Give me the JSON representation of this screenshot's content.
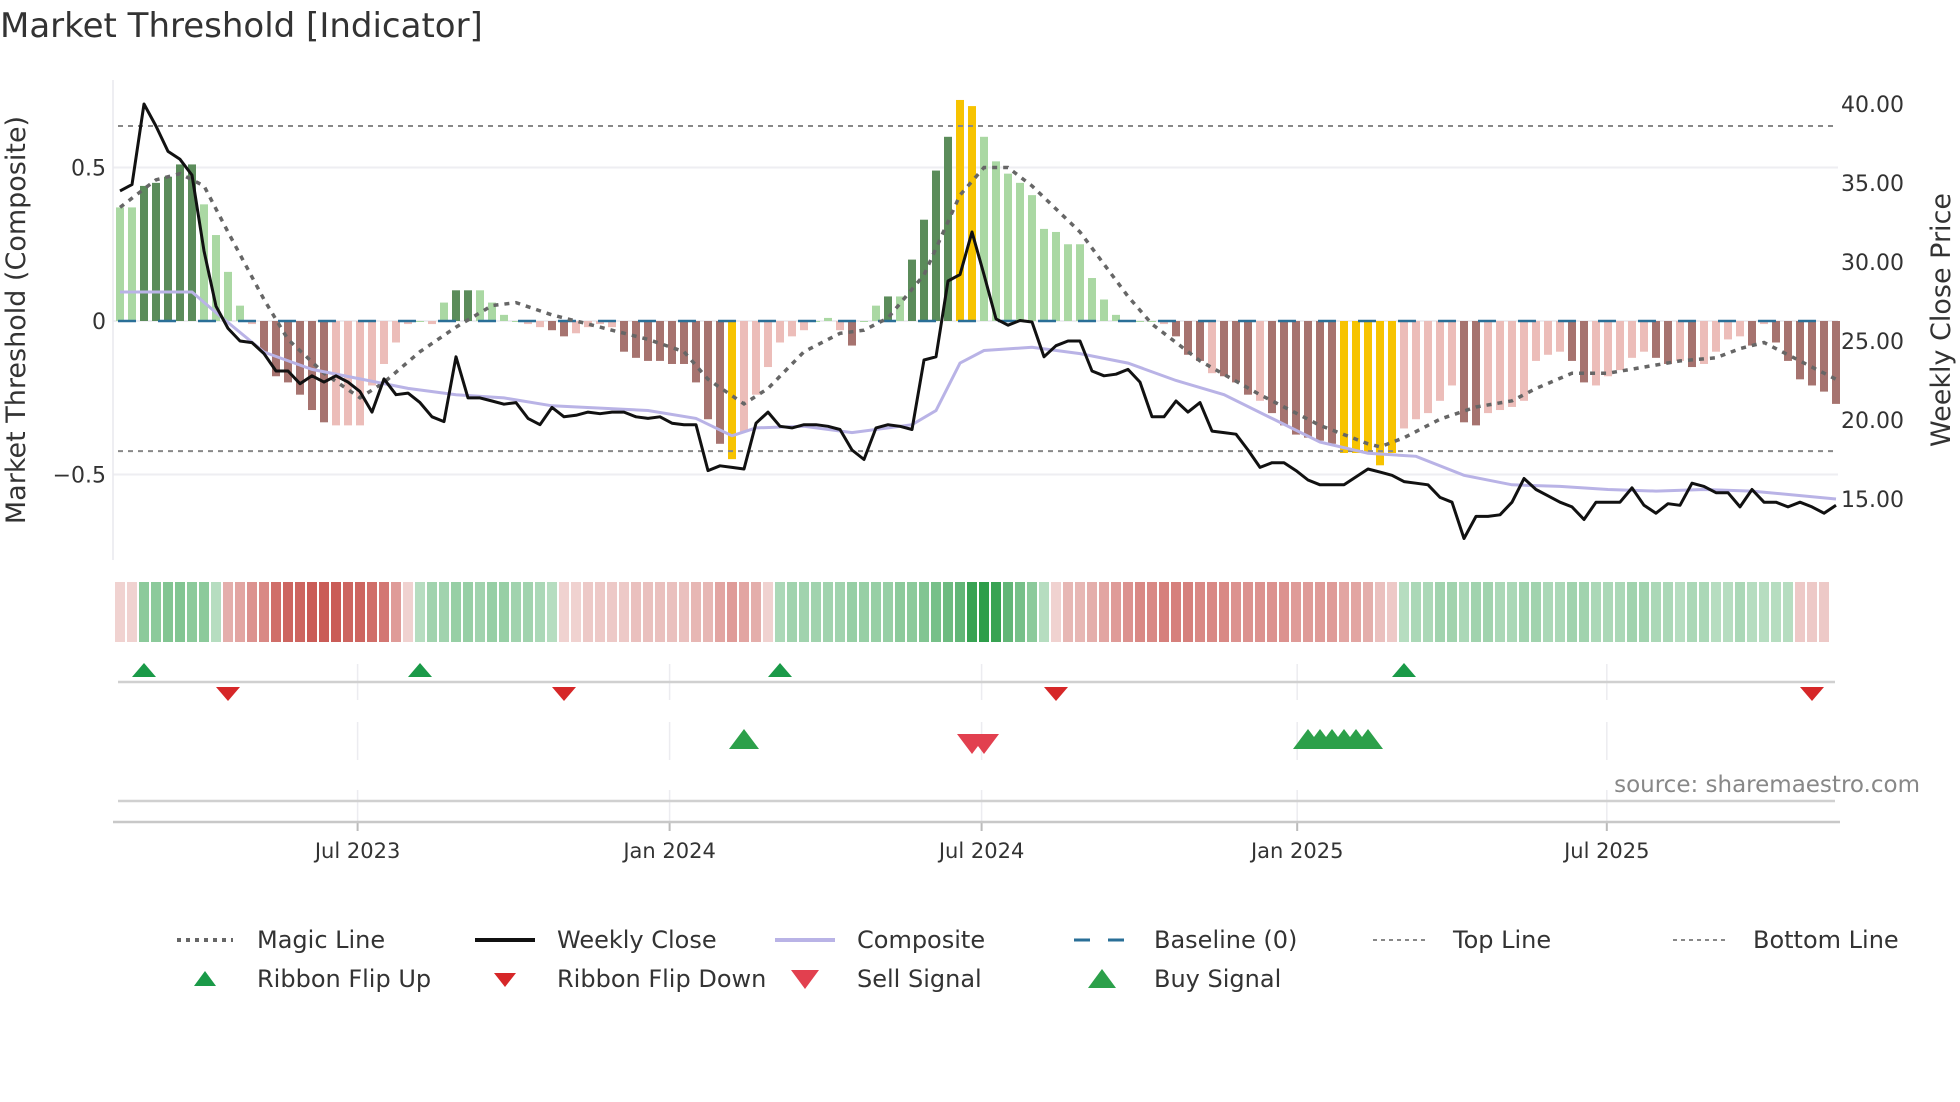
{
  "title": "Market Threshold [Indicator]",
  "source": "source: sharemaestro.com",
  "colors": {
    "dark_green": "#5b8c5a",
    "light_green": "#aad8a3",
    "dark_red": "#a6736f",
    "light_red": "#ecbdb9",
    "extreme": "#f7c300",
    "weekly_close": "#111111",
    "composite": "#b9b3e6",
    "magic": "#666666",
    "baseline": "#2a6f97",
    "flip_up": "#1a9a48",
    "flip_down": "#d62728",
    "buy": "#2ca04a",
    "sell": "#e2404f"
  },
  "chart_data": {
    "type": "bar",
    "title": "Market Threshold [Indicator]",
    "ylabel_left": "Market Threshold (Composite)",
    "ylabel_right": "Weekly Close Price",
    "ylim_left": [
      -0.62,
      0.75
    ],
    "ylim_right": [
      11,
      42
    ],
    "left_ticks": [
      {
        "label": "0.5",
        "value": 0.5
      },
      {
        "label": "0",
        "value": 0
      },
      {
        "label": "−0.5",
        "value": -0.5
      }
    ],
    "right_ticks": [
      {
        "label": "40.00",
        "value": 40
      },
      {
        "label": "35.00",
        "value": 35
      },
      {
        "label": "30.00",
        "value": 30
      },
      {
        "label": "25.00",
        "value": 25
      },
      {
        "label": "20.00",
        "value": 20
      },
      {
        "label": "15.00",
        "value": 15
      }
    ],
    "x_ticks": [
      {
        "label": "Jul 2023",
        "week": 19.8
      },
      {
        "label": "Jan 2024",
        "week": 45.8
      },
      {
        "label": "Jul 2024",
        "week": 71.8
      },
      {
        "label": "Jan 2025",
        "week": 98.1
      },
      {
        "label": "Jul 2025",
        "week": 123.9
      }
    ],
    "top_line": 0.635,
    "bottom_line": -0.424,
    "composite_bars": [
      0.37,
      0.37,
      0.44,
      0.45,
      0.47,
      0.51,
      0.51,
      0.38,
      0.28,
      0.16,
      0.05,
      -0.01,
      -0.1,
      -0.18,
      -0.2,
      -0.24,
      -0.29,
      -0.33,
      -0.34,
      -0.34,
      -0.34,
      -0.21,
      -0.14,
      -0.07,
      -0.01,
      0,
      -0.01,
      0.06,
      0.1,
      0.1,
      0.1,
      0.06,
      0.02,
      0,
      -0.01,
      -0.02,
      -0.03,
      -0.05,
      -0.04,
      -0.02,
      -0.01,
      -0.02,
      -0.1,
      -0.12,
      -0.13,
      -0.13,
      -0.14,
      -0.14,
      -0.2,
      -0.32,
      -0.4,
      -0.45,
      -0.36,
      -0.24,
      -0.15,
      -0.07,
      -0.05,
      -0.03,
      0,
      0.01,
      -0.03,
      -0.08,
      0,
      0.05,
      0.08,
      0.08,
      0.2,
      0.33,
      0.49,
      0.6,
      0.72,
      0.7,
      0.6,
      0.52,
      0.48,
      0.45,
      0.41,
      0.3,
      0.29,
      0.25,
      0.25,
      0.14,
      0.07,
      0.02,
      0,
      0,
      0,
      -0.01,
      -0.05,
      -0.11,
      -0.13,
      -0.17,
      -0.18,
      -0.2,
      -0.24,
      -0.26,
      -0.3,
      -0.34,
      -0.37,
      -0.38,
      -0.39,
      -0.4,
      -0.43,
      -0.43,
      -0.43,
      -0.47,
      -0.43,
      -0.35,
      -0.32,
      -0.3,
      -0.26,
      -0.21,
      -0.33,
      -0.34,
      -0.3,
      -0.29,
      -0.28,
      -0.26,
      -0.13,
      -0.11,
      -0.1,
      -0.13,
      -0.2,
      -0.21,
      -0.18,
      -0.16,
      -0.12,
      -0.1,
      -0.12,
      -0.14,
      -0.13,
      -0.15,
      -0.14,
      -0.1,
      -0.06,
      -0.05,
      -0.08,
      -0.01,
      -0.07,
      -0.13,
      -0.19,
      -0.21,
      -0.23,
      -0.27
    ],
    "bar_shade": "LLDDDDDLLLLLDDDDDDLLLLLLLLLLDDLLLLLLDDLLLLDDDDDDDDDYLLLLLLLLLDLLDLDDDDYYLLLLLLLLLLLLLLLLDDDLDDDLDDDDDDYYYYYLLLLLDDLLLLLLLDDLLLLLDDLDLLLLDLDDDDDD",
    "weekly_close": [
      34.5,
      34.9,
      40,
      38.6,
      37,
      36.5,
      35.5,
      30.7,
      27.2,
      25.8,
      25,
      24.9,
      24.2,
      23.1,
      23.1,
      22.3,
      22.8,
      22.4,
      22.8,
      22.4,
      21.8,
      20.5,
      22.6,
      21.6,
      21.7,
      21.1,
      20.2,
      19.9,
      24,
      21.4,
      21.4,
      21.2,
      21,
      21.1,
      20.1,
      19.7,
      20.8,
      20.2,
      20.3,
      20.5,
      20.4,
      20.5,
      20.5,
      20.2,
      20.1,
      20.2,
      19.8,
      19.7,
      19.7,
      16.8,
      17.1,
      17,
      16.9,
      19.8,
      20.5,
      19.6,
      19.5,
      19.7,
      19.7,
      19.6,
      19.4,
      18.1,
      17.5,
      19.5,
      19.7,
      19.6,
      19.4,
      23.8,
      24,
      28.8,
      29.2,
      31.9,
      29.2,
      26.4,
      26,
      26.3,
      26.2,
      24,
      24.7,
      25,
      25,
      23.1,
      22.8,
      22.9,
      23.2,
      22.4,
      20.2,
      20.2,
      21.2,
      20.5,
      21.1,
      19.3,
      19.2,
      19.1,
      18.1,
      17,
      17.3,
      17.3,
      16.8,
      16.2,
      15.9,
      15.9,
      15.9,
      16.4,
      16.9,
      16.7,
      16.5,
      16.1,
      16,
      15.9,
      15.1,
      14.8,
      12.5,
      13.9,
      13.9,
      14,
      14.8,
      16.3,
      15.6,
      15.2,
      14.8,
      14.5,
      13.7,
      14.8,
      14.8,
      14.8,
      15.7,
      14.6,
      14.1,
      14.7,
      14.6,
      16,
      15.8,
      15.4,
      15.4,
      14.5,
      15.6,
      14.8,
      14.8,
      14.5,
      14.8,
      14.5,
      14.1,
      14.6
    ],
    "composite_line": [
      [
        0,
        28.1
      ],
      [
        6,
        28.1
      ],
      [
        8,
        26.8
      ],
      [
        12,
        24.3
      ],
      [
        16,
        23.2
      ],
      [
        20,
        22.6
      ],
      [
        24,
        22
      ],
      [
        28,
        21.6
      ],
      [
        32,
        21.4
      ],
      [
        36,
        20.9
      ],
      [
        44,
        20.6
      ],
      [
        48,
        20.1
      ],
      [
        51,
        19
      ],
      [
        53,
        19.5
      ],
      [
        57,
        19.6
      ],
      [
        61,
        19.2
      ],
      [
        66,
        19.7
      ],
      [
        68,
        20.6
      ],
      [
        70,
        23.6
      ],
      [
        72,
        24.4
      ],
      [
        76,
        24.6
      ],
      [
        80,
        24.2
      ],
      [
        84,
        23.6
      ],
      [
        88,
        22.5
      ],
      [
        92,
        21.6
      ],
      [
        96,
        20.1
      ],
      [
        100,
        18.6
      ],
      [
        104,
        17.9
      ],
      [
        108,
        17.7
      ],
      [
        112,
        16.5
      ],
      [
        116,
        15.9
      ],
      [
        120,
        15.8
      ],
      [
        124,
        15.6
      ],
      [
        128,
        15.5
      ],
      [
        132,
        15.6
      ],
      [
        136,
        15.5
      ],
      [
        143,
        15
      ]
    ],
    "magic_line": [
      [
        0,
        0.37
      ],
      [
        3,
        0.46
      ],
      [
        5,
        0.48
      ],
      [
        7,
        0.44
      ],
      [
        9,
        0.29
      ],
      [
        12,
        0.07
      ],
      [
        14,
        -0.06
      ],
      [
        17,
        -0.17
      ],
      [
        20,
        -0.25
      ],
      [
        22,
        -0.2
      ],
      [
        25,
        -0.1
      ],
      [
        28,
        -0.02
      ],
      [
        31,
        0.05
      ],
      [
        33,
        0.06
      ],
      [
        36,
        0.02
      ],
      [
        40,
        -0.02
      ],
      [
        44,
        -0.06
      ],
      [
        47,
        -0.1
      ],
      [
        49,
        -0.19
      ],
      [
        52,
        -0.27
      ],
      [
        54,
        -0.22
      ],
      [
        57,
        -0.1
      ],
      [
        60,
        -0.04
      ],
      [
        62,
        -0.03
      ],
      [
        64,
        0.01
      ],
      [
        67,
        0.15
      ],
      [
        70,
        0.41
      ],
      [
        72,
        0.5
      ],
      [
        74,
        0.5
      ],
      [
        76,
        0.44
      ],
      [
        80,
        0.29
      ],
      [
        84,
        0.08
      ],
      [
        86,
        -0.01
      ],
      [
        90,
        -0.13
      ],
      [
        95,
        -0.24
      ],
      [
        100,
        -0.34
      ],
      [
        104,
        -0.4
      ],
      [
        105,
        -0.41
      ],
      [
        107,
        -0.38
      ],
      [
        110,
        -0.32
      ],
      [
        113,
        -0.28
      ],
      [
        116,
        -0.26
      ],
      [
        118,
        -0.22
      ],
      [
        121,
        -0.17
      ],
      [
        124,
        -0.17
      ],
      [
        127,
        -0.15
      ],
      [
        130,
        -0.13
      ],
      [
        133,
        -0.12
      ],
      [
        135,
        -0.09
      ],
      [
        137,
        -0.07
      ],
      [
        139,
        -0.11
      ],
      [
        141,
        -0.15
      ],
      [
        143,
        -0.19
      ]
    ],
    "ribbon": [
      -0.15,
      -0.15,
      0.4,
      0.4,
      0.45,
      0.45,
      0.4,
      0.4,
      0.2,
      -0.35,
      -0.4,
      -0.5,
      -0.55,
      -0.7,
      -0.75,
      -0.75,
      -0.8,
      -0.8,
      -0.8,
      -0.75,
      -0.75,
      -0.7,
      -0.65,
      -0.45,
      -0.15,
      0.2,
      0.3,
      0.3,
      0.35,
      0.35,
      0.3,
      0.35,
      0.35,
      0.3,
      0.3,
      0.25,
      0.2,
      -0.15,
      -0.15,
      -0.2,
      -0.2,
      -0.2,
      -0.2,
      -0.25,
      -0.25,
      -0.25,
      -0.25,
      -0.25,
      -0.3,
      -0.3,
      -0.4,
      -0.45,
      -0.4,
      -0.35,
      -0.15,
      0.25,
      0.3,
      0.3,
      0.3,
      0.3,
      0.3,
      0.35,
      0.35,
      0.35,
      0.35,
      0.4,
      0.4,
      0.45,
      0.5,
      0.55,
      0.6,
      0.8,
      0.85,
      0.8,
      0.6,
      0.5,
      0.4,
      0.2,
      -0.15,
      -0.3,
      -0.3,
      -0.35,
      -0.4,
      -0.45,
      -0.5,
      -0.55,
      -0.55,
      -0.6,
      -0.6,
      -0.6,
      -0.55,
      -0.55,
      -0.55,
      -0.5,
      -0.5,
      -0.5,
      -0.5,
      -0.5,
      -0.45,
      -0.45,
      -0.45,
      -0.45,
      -0.4,
      -0.4,
      -0.35,
      -0.25,
      -0.2,
      0.2,
      0.25,
      0.25,
      0.3,
      0.3,
      0.25,
      0.3,
      0.3,
      0.25,
      0.25,
      0.3,
      0.3,
      0.25,
      0.25,
      0.3,
      0.3,
      0.25,
      0.25,
      0.25,
      0.3,
      0.3,
      0.25,
      0.25,
      0.2,
      0.25,
      0.25,
      0.2,
      0.2,
      0.25,
      0.2,
      0.2,
      0.2,
      0.2,
      -0.2,
      -0.2,
      -0.2
    ],
    "ribbon_flip_up": [
      2,
      25,
      55,
      107
    ],
    "ribbon_flip_down": [
      9,
      37,
      78,
      141
    ],
    "buy_signals": [
      52,
      99,
      100,
      101,
      102,
      103,
      104
    ],
    "sell_signals": [
      71,
      72
    ],
    "legend": [
      {
        "label": "Magic Line",
        "kind": "dotted"
      },
      {
        "label": "Weekly Close",
        "kind": "solid"
      },
      {
        "label": "Composite",
        "kind": "lavender"
      },
      {
        "label": "Baseline (0)",
        "kind": "dashed"
      },
      {
        "label": "Top Line",
        "kind": "thindot"
      },
      {
        "label": "Bottom Line",
        "kind": "thindot"
      },
      {
        "label": "Ribbon Flip Up",
        "kind": "up-small"
      },
      {
        "label": "Ribbon Flip Down",
        "kind": "down-small"
      },
      {
        "label": "Sell Signal",
        "kind": "down-big"
      },
      {
        "label": "Buy Signal",
        "kind": "up-big"
      }
    ]
  }
}
